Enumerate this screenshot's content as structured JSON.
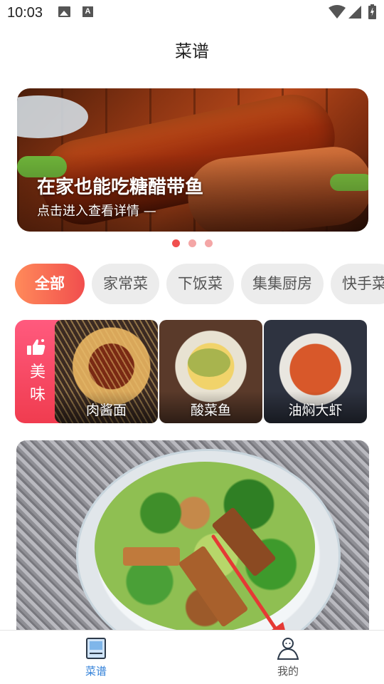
{
  "status_bar": {
    "time": "10:03",
    "icons": [
      "image-icon",
      "a-icon",
      "wifi-icon",
      "signal-icon",
      "battery-icon"
    ]
  },
  "header": {
    "title": "菜谱"
  },
  "banner": {
    "title": "在家也能吃糖醋带鱼",
    "subtitle": "点击进入查看详情 —",
    "dots": 3,
    "active_dot": 0
  },
  "categories": [
    {
      "label": "全部",
      "active": true
    },
    {
      "label": "家常菜",
      "active": false
    },
    {
      "label": "下饭菜",
      "active": false
    },
    {
      "label": "集集厨房",
      "active": false
    },
    {
      "label": "快手菜",
      "active": false
    }
  ],
  "tasty": {
    "label": "美味",
    "icon": "thumbs-up-icon",
    "dishes": [
      {
        "name": "肉酱面"
      },
      {
        "name": "酸菜鱼"
      },
      {
        "name": "油焖大虾"
      }
    ]
  },
  "bottom_nav": {
    "items": [
      {
        "label": "菜谱",
        "icon": "book-icon",
        "active": true
      },
      {
        "label": "我的",
        "icon": "person-icon",
        "active": false
      }
    ]
  },
  "colors": {
    "accent_blue": "#2f7fd8",
    "chip_active_start": "#ff8a5a",
    "chip_active_end": "#f14e4e",
    "dot_active": "#f0504f",
    "annotation_arrow": "#e53935"
  }
}
